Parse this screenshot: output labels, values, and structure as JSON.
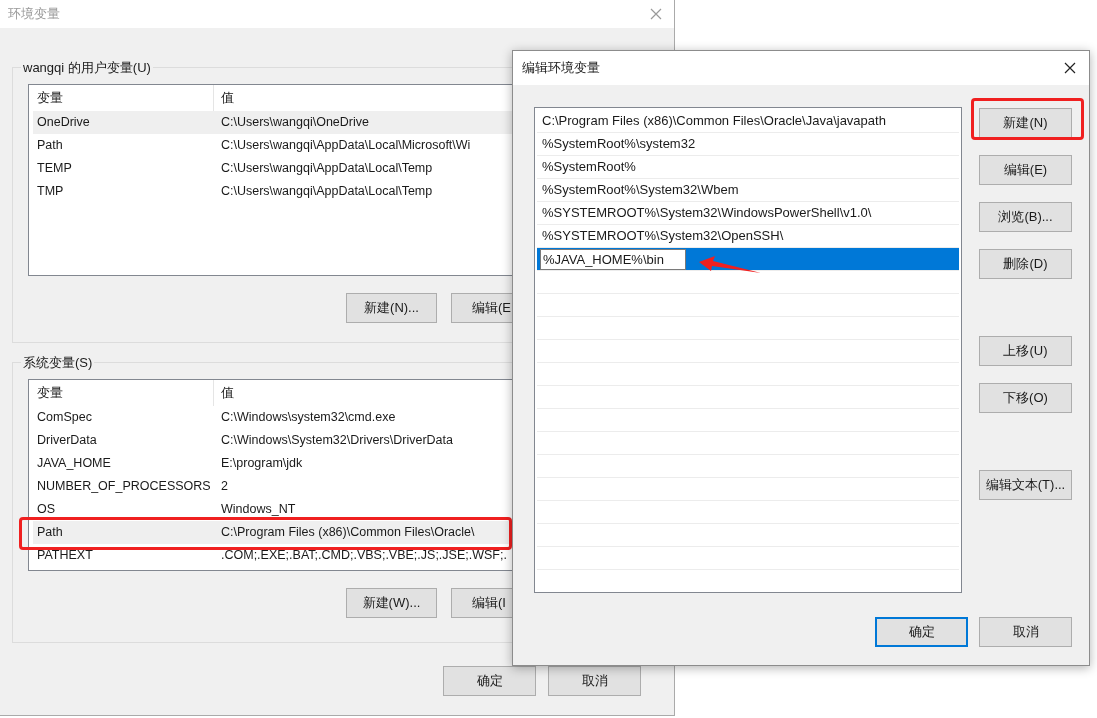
{
  "back_window": {
    "title": "环境变量",
    "user_group": {
      "label": "wangqi 的用户变量(U)",
      "columns": [
        "变量",
        "值"
      ],
      "rows": [
        {
          "name": "OneDrive",
          "value": "C:\\Users\\wangqi\\OneDrive",
          "selected": true,
          "annotated": false
        },
        {
          "name": "Path",
          "value": "C:\\Users\\wangqi\\AppData\\Local\\Microsoft\\Wi",
          "selected": false,
          "annotated": false
        },
        {
          "name": "TEMP",
          "value": "C:\\Users\\wangqi\\AppData\\Local\\Temp",
          "selected": false,
          "annotated": false
        },
        {
          "name": "TMP",
          "value": "C:\\Users\\wangqi\\AppData\\Local\\Temp",
          "selected": false,
          "annotated": false
        }
      ],
      "buttons": [
        "新建(N)...",
        "编辑(E"
      ]
    },
    "system_group": {
      "label": "系统变量(S)",
      "columns": [
        "变量",
        "值"
      ],
      "rows": [
        {
          "name": "ComSpec",
          "value": "C:\\Windows\\system32\\cmd.exe",
          "selected": false,
          "annotated": false
        },
        {
          "name": "DriverData",
          "value": "C:\\Windows\\System32\\Drivers\\DriverData",
          "selected": false,
          "annotated": false
        },
        {
          "name": "JAVA_HOME",
          "value": "E:\\program\\jdk",
          "selected": false,
          "annotated": false
        },
        {
          "name": "NUMBER_OF_PROCESSORS",
          "value": "2",
          "selected": false,
          "annotated": false
        },
        {
          "name": "OS",
          "value": "Windows_NT",
          "selected": false,
          "annotated": false
        },
        {
          "name": "Path",
          "value": "C:\\Program Files (x86)\\Common Files\\Oracle\\",
          "selected": true,
          "annotated": true
        },
        {
          "name": "PATHEXT",
          "value": ".COM;.EXE;.BAT;.CMD;.VBS;.VBE;.JS;.JSE;.WSF;.",
          "selected": false,
          "annotated": false
        }
      ],
      "buttons": [
        "新建(W)...",
        "编辑(I"
      ]
    },
    "buttons": [
      "确定",
      "取消"
    ]
  },
  "front_window": {
    "title": "编辑环境变量",
    "entries": [
      {
        "text": "C:\\Program Files (x86)\\Common Files\\Oracle\\Java\\javapath",
        "selected": false,
        "editing": false,
        "arrow": false
      },
      {
        "text": "%SystemRoot%\\system32",
        "selected": false,
        "editing": false,
        "arrow": false
      },
      {
        "text": "%SystemRoot%",
        "selected": false,
        "editing": false,
        "arrow": false
      },
      {
        "text": "%SystemRoot%\\System32\\Wbem",
        "selected": false,
        "editing": false,
        "arrow": false
      },
      {
        "text": "%SYSTEMROOT%\\System32\\WindowsPowerShell\\v1.0\\",
        "selected": false,
        "editing": false,
        "arrow": false
      },
      {
        "text": "%SYSTEMROOT%\\System32\\OpenSSH\\",
        "selected": false,
        "editing": false,
        "arrow": false
      },
      {
        "text": "%JAVA_HOME%\\bin",
        "selected": true,
        "editing": true,
        "arrow": true
      }
    ],
    "side_buttons": [
      {
        "label": "新建(N)",
        "annotated": true
      },
      {
        "label": "编辑(E)",
        "annotated": false
      },
      {
        "label": "浏览(B)...",
        "annotated": false
      },
      {
        "label": "删除(D)",
        "annotated": false
      },
      {
        "label": "上移(U)",
        "annotated": false
      },
      {
        "label": "下移(O)",
        "annotated": false
      },
      {
        "label": "编辑文本(T)...",
        "annotated": false
      }
    ],
    "buttons": [
      {
        "label": "确定",
        "default": true
      },
      {
        "label": "取消",
        "default": false
      }
    ]
  }
}
